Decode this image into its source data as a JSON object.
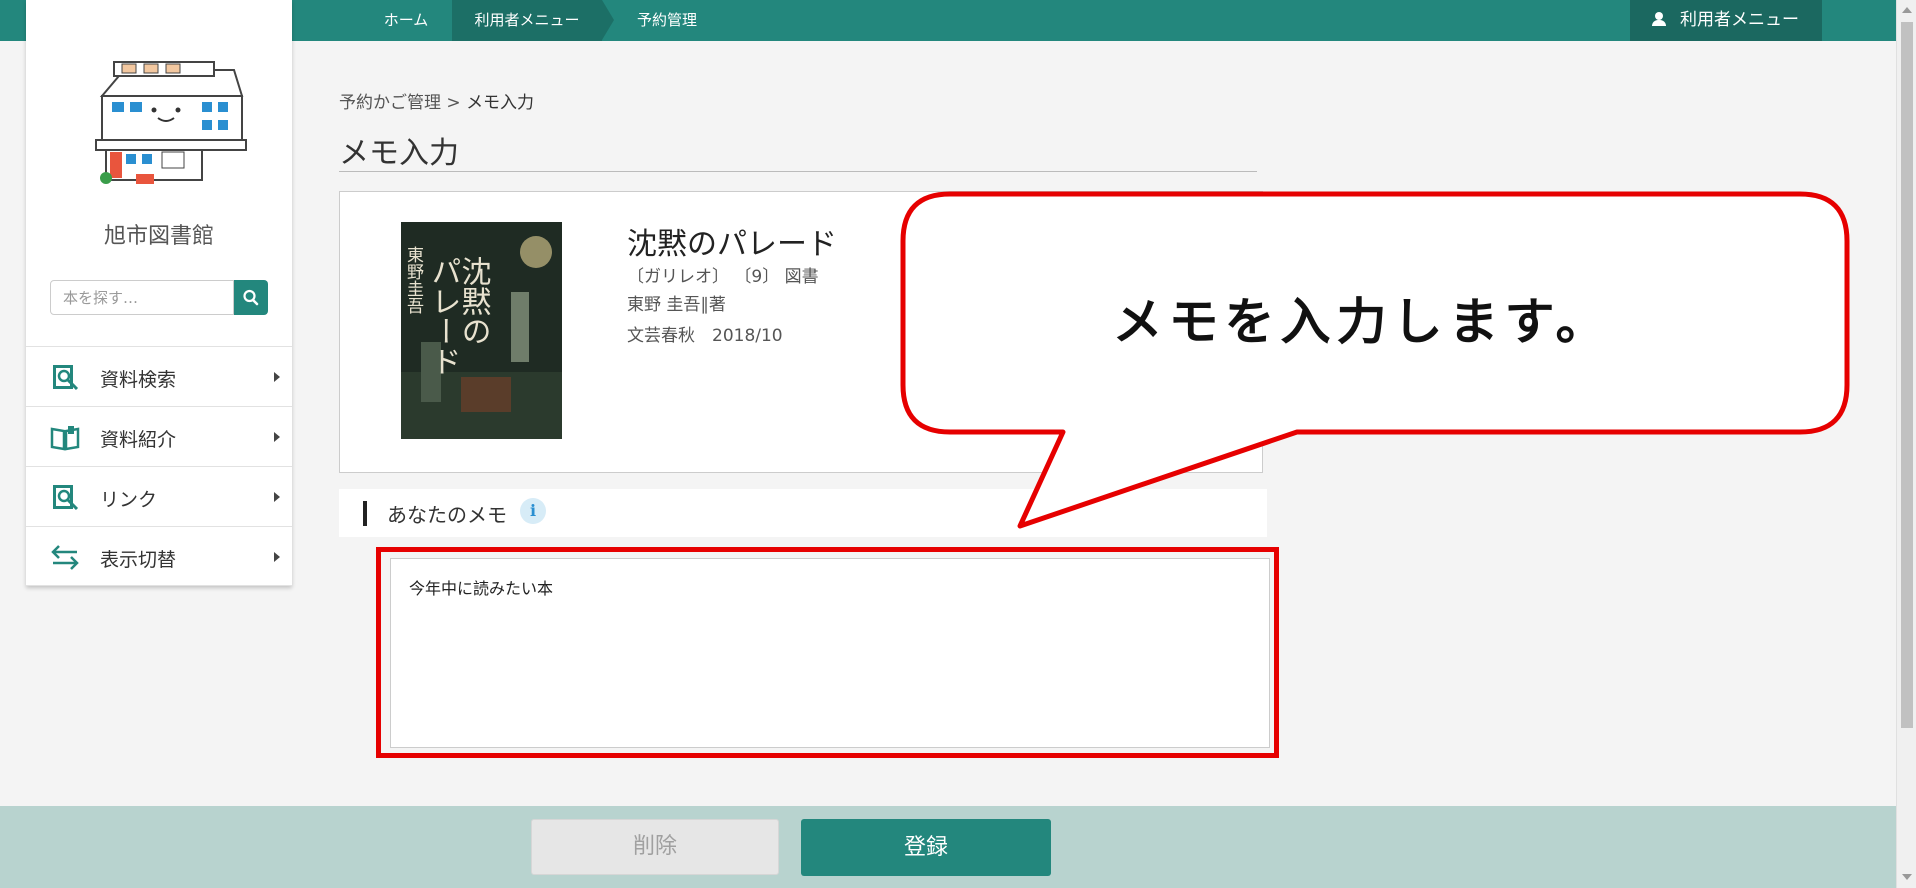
{
  "header": {
    "breadcrumb": [
      {
        "label": "ホーム"
      },
      {
        "label": "利用者メニュー"
      },
      {
        "label": "予約管理"
      }
    ],
    "user_menu_label": "利用者メニュー",
    "accent_color": "#23877d"
  },
  "sidebar": {
    "library_name": "旭市図書館",
    "search_placeholder": "本を探す…",
    "items": [
      {
        "label": "資料検索",
        "icon": "book-search-icon"
      },
      {
        "label": "資料紹介",
        "icon": "open-book-icon"
      },
      {
        "label": "リンク",
        "icon": "link-search-icon"
      },
      {
        "label": "表示切替",
        "icon": "swap-arrows-icon"
      }
    ]
  },
  "main": {
    "breadcrumb_parent": "予約かご管理",
    "breadcrumb_sep": ">",
    "breadcrumb_current": "メモ入力",
    "page_title": "メモ入力",
    "book": {
      "title": "沈黙のパレード",
      "series": "〔ガリレオ〕 〔9〕 図書",
      "author": "東野 圭吾∥著",
      "publisher": "文芸春秋　2018/10",
      "cover_title": "沈黙のパレード",
      "cover_author": "東野圭吾"
    },
    "memo_label": "あなたのメモ",
    "info_icon": "info-icon",
    "memo_value": "今年中に読みたい本"
  },
  "callout": {
    "text": "メモを入力します。",
    "highlight_color": "#e60000"
  },
  "footer": {
    "delete_label": "削除",
    "register_label": "登録"
  }
}
